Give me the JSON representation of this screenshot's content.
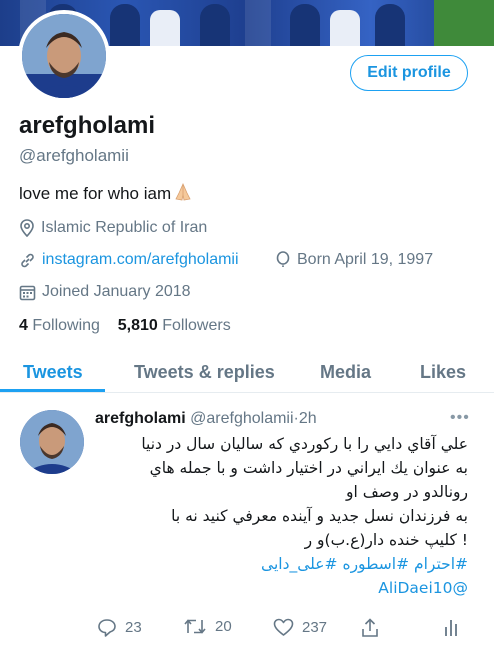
{
  "profile": {
    "display_name": "arefgholami",
    "handle": "@arefgholamii",
    "bio": "love me for who iam",
    "bio_emoji": "folded-hands-emoji",
    "location": "Islamic Republic of Iran",
    "website": "instagram.com/arefgholamii",
    "born": "Born April 19, 1997",
    "joined": "Joined January 2018",
    "following_count": "4",
    "following_label": "Following",
    "followers_count": "5,810",
    "followers_label": "Followers",
    "edit_profile_label": "Edit profile"
  },
  "tabs": [
    {
      "label": "Tweets",
      "active": true
    },
    {
      "label": "Tweets & replies",
      "active": false
    },
    {
      "label": "Media",
      "active": false
    },
    {
      "label": "Likes",
      "active": false
    }
  ],
  "tweet": {
    "author_name": "arefgholami",
    "author_handle": "@arefgholamii",
    "separator": "·",
    "time": "2h",
    "lines": [
      "علي آقاي دايي را با ركوردي كه ساليان سال  در دنيا",
      "به عنوان يك ايراني در اختيار داشت و با جمله هاي",
      "رونالدو در وصف او",
      "به فرزندان نسل جديد و آينده معرفي كنيد نه با",
      "! كليپ خنده دار(ع.ب)و ر"
    ],
    "hashtags": "#احترام #اسطوره #علی_دایی",
    "mention": "@AliDaei10",
    "reply_count": "23",
    "retweet_count": "20",
    "like_count": "237"
  },
  "colors": {
    "accent": "#1da1f2",
    "link": "#1b95e0",
    "muted": "#657786"
  }
}
